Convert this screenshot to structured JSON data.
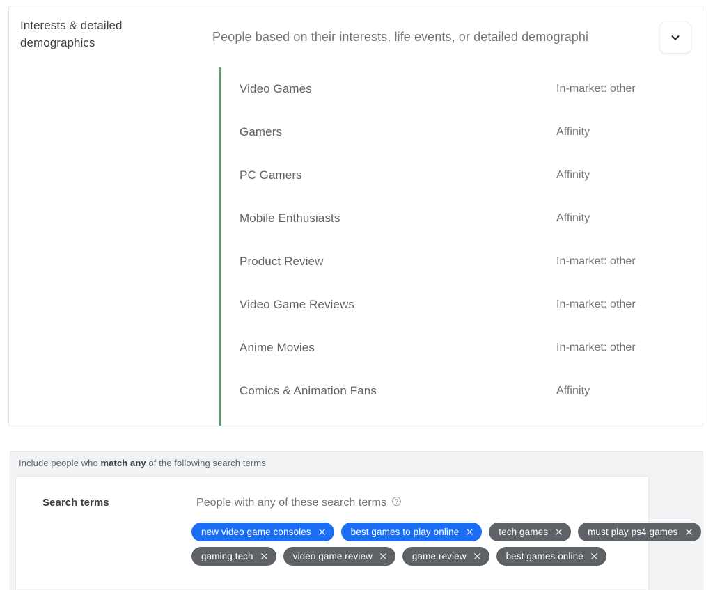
{
  "interests_card": {
    "section_label": "Interests & detailed demographics",
    "description": "People based on their interests, life events, or detailed demographi",
    "expand_icon": "chevron-down-icon",
    "rows": [
      {
        "name": "Video Games",
        "category": "In-market: other"
      },
      {
        "name": "Gamers",
        "category": "Affinity"
      },
      {
        "name": "PC Gamers",
        "category": "Affinity"
      },
      {
        "name": "Mobile Enthusiasts",
        "category": "Affinity"
      },
      {
        "name": "Product Review",
        "category": "In-market: other"
      },
      {
        "name": "Video Game Reviews",
        "category": "In-market: other"
      },
      {
        "name": "Anime Movies",
        "category": "In-market: other"
      },
      {
        "name": "Comics & Animation Fans",
        "category": "Affinity"
      }
    ],
    "accent_color": "#5f9e6e"
  },
  "search_panel": {
    "header_prefix": "Include people who ",
    "header_bold": "match any",
    "header_suffix": " of the following search terms",
    "label": "Search terms",
    "description": "People with any of these search terms",
    "help_icon": "help-circle-icon",
    "chip_colors": {
      "selected": "#1b6ef3",
      "default": "#5f6368"
    },
    "chip_rows": [
      [
        {
          "label": "new video game consoles",
          "style": "blue"
        },
        {
          "label": "best games to play online",
          "style": "blue"
        },
        {
          "label": "tech games",
          "style": "gray"
        },
        {
          "label": "must play ps4 games",
          "style": "gray"
        }
      ],
      [
        {
          "label": "gaming tech",
          "style": "gray"
        },
        {
          "label": "video game review",
          "style": "gray"
        },
        {
          "label": "game review",
          "style": "gray"
        },
        {
          "label": "best games online",
          "style": "gray"
        }
      ]
    ],
    "chip_close_icon": "close-icon"
  }
}
